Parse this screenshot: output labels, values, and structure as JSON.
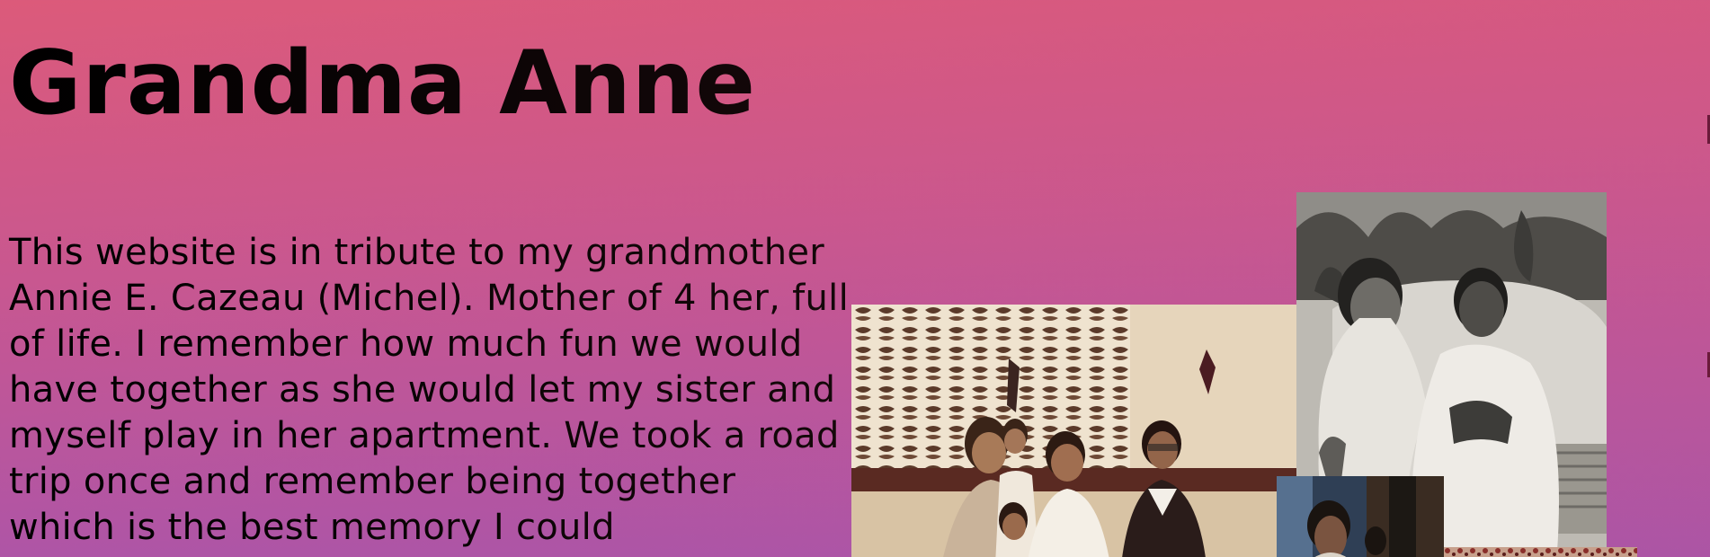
{
  "header": {
    "title": "Grandma Anne"
  },
  "main": {
    "intro_text": "This website is in tribute to my grandmother Annie E. Cazeau (Michel). Mother of 4 her, full of life. I remember how much fun we would have together as she would let my sister and myself play in her apartment. We took a road trip once and remember being together which is the best memory I could"
  },
  "gallery": {
    "photos": [
      {
        "name": "family-group-photo",
        "tone": "sepia"
      },
      {
        "name": "couple-photo",
        "tone": "black-and-white"
      },
      {
        "name": "portrait-photo",
        "tone": "color"
      },
      {
        "name": "pattern-photo",
        "tone": "color"
      }
    ]
  },
  "colors": {
    "background_top": "#dc5a7a",
    "background_bottom": "#9f54b1",
    "text": "#000000"
  }
}
